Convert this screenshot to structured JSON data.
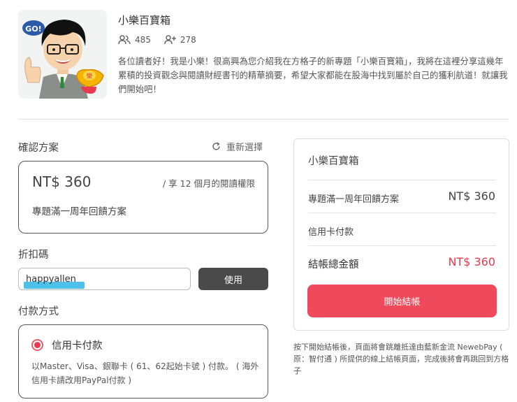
{
  "header": {
    "title": "小樂百寶箱",
    "followers": "485",
    "following": "278",
    "description": "各位讀者好！我是小樂！很高興為您介紹我在方格子的新專題「小樂百寶箱」，我將在這裡分享這幾年累積的投資觀念與閱讀財經書刊的精華摘要，希望大家都能在股海中找到屬於自己的獲利航道！就讓我們開始吧！",
    "avatar_badge": "GO!",
    "avatar_coin": "榮"
  },
  "plan_section": {
    "label": "確認方案",
    "reselect_label": "重新選擇",
    "price": "NT$ 360",
    "period": "/ 享 12 個月的閱讀權限",
    "plan_name": "專題滿一周年回饋方案"
  },
  "coupon": {
    "label": "折扣碼",
    "value": "happyallen",
    "button_label": "使用"
  },
  "payment": {
    "label": "付款方式",
    "option_label": "信用卡付款",
    "option_desc": "以Master、Visa、銀聯卡 ( 61、62起始卡號 ) 付款。 ( 海外信用卡請改用PayPal付款 )"
  },
  "summary": {
    "title": "小樂百寶箱",
    "plan_label": "專題滿一周年回饋方案",
    "plan_price": "NT$ 360",
    "payment_method": "信用卡付款",
    "total_label": "結帳總金額",
    "total_value": "NT$ 360",
    "checkout_label": "開始結帳"
  },
  "note": "按下開始結帳後，頁面將會跳離抵達由藍新金流 NewebPay ( 原：智付通 ) 所提供的線上結帳頁面，完成後將會再跳回到方格子",
  "colors": {
    "accent": "#ef4a5b",
    "total": "#e8394f",
    "dark_button": "#4a4a4a",
    "highlight": "#4ec1ea"
  }
}
